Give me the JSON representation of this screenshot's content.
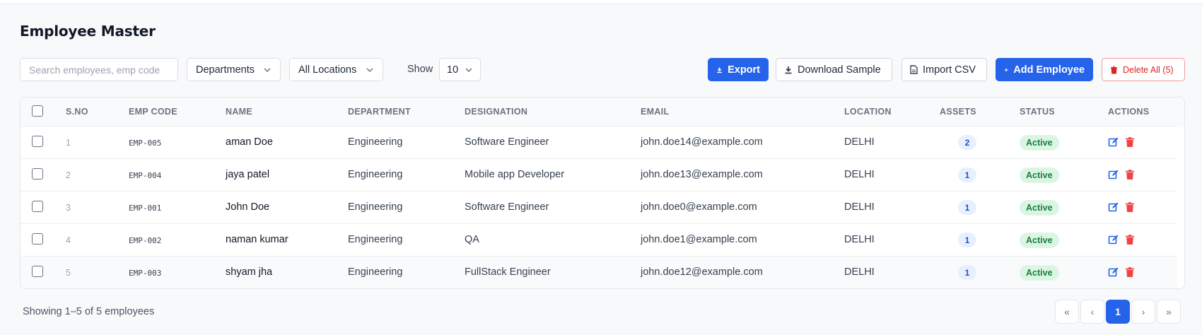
{
  "page": {
    "title": "Employee Master"
  },
  "toolbar": {
    "search_placeholder": "Search employees, emp code",
    "department_filter": "Departments",
    "location_filter": "All Locations",
    "show_label": "Show",
    "page_size": "10",
    "export_label": "Export",
    "download_sample_label": "Download Sample",
    "import_csv_label": "Import CSV",
    "add_employee_label": "Add Employee",
    "delete_all_label": "Delete All (5)"
  },
  "table": {
    "columns": [
      "S.NO",
      "EMP CODE",
      "NAME",
      "DEPARTMENT",
      "DESIGNATION",
      "EMAIL",
      "LOCATION",
      "ASSETS",
      "STATUS",
      "ACTIONS"
    ],
    "rows": [
      {
        "sno": "1",
        "code": "EMP-005",
        "name": "aman Doe",
        "department": "Engineering",
        "designation": "Software Engineer",
        "email": "john.doe14@example.com",
        "location": "DELHI",
        "assets": "2",
        "status": "Active"
      },
      {
        "sno": "2",
        "code": "EMP-004",
        "name": "jaya patel",
        "department": "Engineering",
        "designation": "Mobile app Developer",
        "email": "john.doe13@example.com",
        "location": "DELHI",
        "assets": "1",
        "status": "Active"
      },
      {
        "sno": "3",
        "code": "EMP-001",
        "name": "John Doe",
        "department": "Engineering",
        "designation": "Software Engineer",
        "email": "john.doe0@example.com",
        "location": "DELHI",
        "assets": "1",
        "status": "Active"
      },
      {
        "sno": "4",
        "code": "EMP-002",
        "name": "naman kumar",
        "department": "Engineering",
        "designation": "QA",
        "email": "john.doe1@example.com",
        "location": "DELHI",
        "assets": "1",
        "status": "Active"
      },
      {
        "sno": "5",
        "code": "EMP-003",
        "name": "shyam jha",
        "department": "Engineering",
        "designation": "FullStack Engineer",
        "email": "john.doe12@example.com",
        "location": "DELHI",
        "assets": "1",
        "status": "Active"
      }
    ]
  },
  "footer": {
    "summary": "Showing 1–5 of 5 employees",
    "pagination": {
      "first": "«",
      "prev": "‹",
      "current": "1",
      "next": "›",
      "last": "»"
    }
  },
  "colors": {
    "primary": "#2563eb",
    "danger": "#dc2626",
    "success_bg": "#dcf5e3",
    "success_text": "#15803d"
  },
  "icons": {
    "export": "download-icon",
    "download_sample": "download-icon",
    "import_csv": "file-icon",
    "add_employee": "plus-icon",
    "delete_all": "trash-icon",
    "row_edit": "edit-icon",
    "row_delete": "trash-icon"
  }
}
